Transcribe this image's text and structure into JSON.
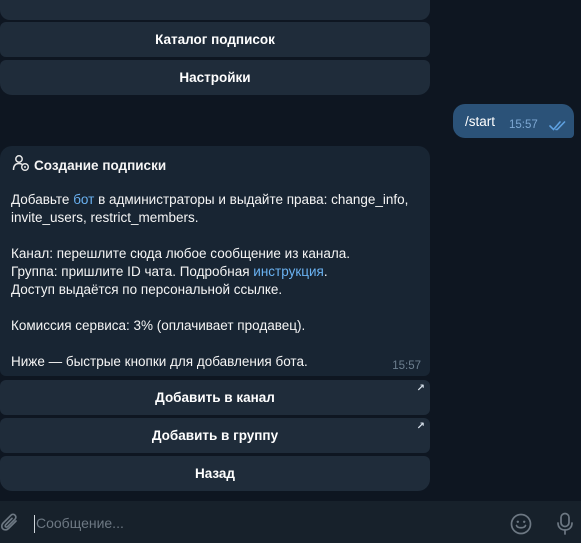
{
  "top_keyboard": {
    "partial_label": "",
    "buttons": [
      {
        "label": "Каталог подписок"
      },
      {
        "label": "Настройки"
      }
    ]
  },
  "outgoing_message": {
    "text": "/start",
    "time": "15:57",
    "status": "read-double-check"
  },
  "incoming_message": {
    "title": "Создание подписки",
    "icon": "user-gear-icon",
    "line1_pre": "Добавьте ",
    "line1_link": "бот",
    "line1_post": " в администраторы и выдайте права: change_info,",
    "line2": "invite_users, restrict_members.",
    "line3": "Канал: перешлите сюда любое сообщение из канала.",
    "line4_pre": "Группа: пришлите ID чата. Подробная ",
    "line4_link": "инструкция",
    "line4_post": ".",
    "line5": "Доступ выдаётся по персональной ссылке.",
    "line6": "Комиссия сервиса: 3% (оплачивает продавец).",
    "line7": "Ниже — быстрые кнопки для добавления бота.",
    "time": "15:57"
  },
  "inline_keyboard": [
    {
      "label": "Добавить в канал",
      "external": true,
      "external_icon": "↗"
    },
    {
      "label": "Добавить в группу",
      "external": true,
      "external_icon": "↗"
    },
    {
      "label": "Назад",
      "external": false
    }
  ],
  "composer": {
    "placeholder": "Сообщение..."
  },
  "colors": {
    "background": "#0e1621",
    "bubble_in": "#182533",
    "bubble_out": "#2b5278",
    "button": "#1f2c3a",
    "link": "#6ab2f2"
  }
}
